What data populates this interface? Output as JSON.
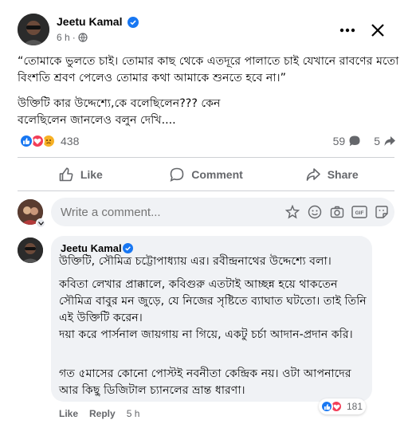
{
  "colors": {
    "accent": "#1877f2",
    "love": "#f33e58",
    "sad": "#f7b125",
    "text": "#050505",
    "secondary": "#65676b",
    "bubble": "#f0f2f5"
  },
  "post": {
    "author": "Jeetu Kamal",
    "time": "6 h",
    "dot": "·",
    "paragraph_1": "“তোমাকে ভুলতে চাই। তোমার কাছ থেকে এতদূরে পালাতে চাই যেখানে রাবণের মতো বিংশতি শ্রবণ পেলেও তোমার কথা আমাকে শুনতে হবে না।”",
    "paragraph_2": "উক্তিটি কার উদ্দেশ্যে,কে বলেছিলেন??? কেন বলেছিলেন জানলেও বলুন দেখি....",
    "reaction_count": "438",
    "comment_count": "59",
    "share_count": "5"
  },
  "actions": {
    "like": "Like",
    "comment": "Comment",
    "share": "Share"
  },
  "composer": {
    "placeholder": "Write a comment..."
  },
  "comment": {
    "author": "Jeetu Kamal",
    "paragraph_1": "উক্তিটি, সৌমিত্র চট্টোপাধ্যায় এর। রবীন্দ্রনাথের উদ্দেশ্যে বলা।",
    "paragraph_2": "কবিতা লেখার প্রাক্কালে, কবিগুরু এতটাই আচ্ছন্ন হয়ে থাকতেন সৌমিত্র বাবুর মন জুড়ে, যে নিজের সৃষ্টিতে ব্যাঘাত ঘটতো। তাই তিনি এই উক্তিটি করেন।",
    "paragraph_3": "দয়া করে পার্সনাল জায়গায় না গিয়ে, একটু চর্চা আদান-প্রদান করি।",
    "paragraph_4": "গত ৫মাসের কোনো পোস্টই নবনীতা কেন্দ্রিক নয়। ওটা আপনাদের আর কিছু ডিজিটাল চ্যানলের ভ্রান্ত ধারণা।",
    "like": "Like",
    "reply": "Reply",
    "time": "5 h",
    "reaction_count": "181"
  },
  "icons": [
    "verified-icon",
    "globe-icon",
    "more-icon",
    "close-icon",
    "like-reaction-icon",
    "love-reaction-icon",
    "sad-reaction-icon",
    "comment-icon",
    "share-icon",
    "sticker-icon",
    "emoji-icon",
    "camera-icon",
    "gif-icon",
    "stickers-icon"
  ]
}
